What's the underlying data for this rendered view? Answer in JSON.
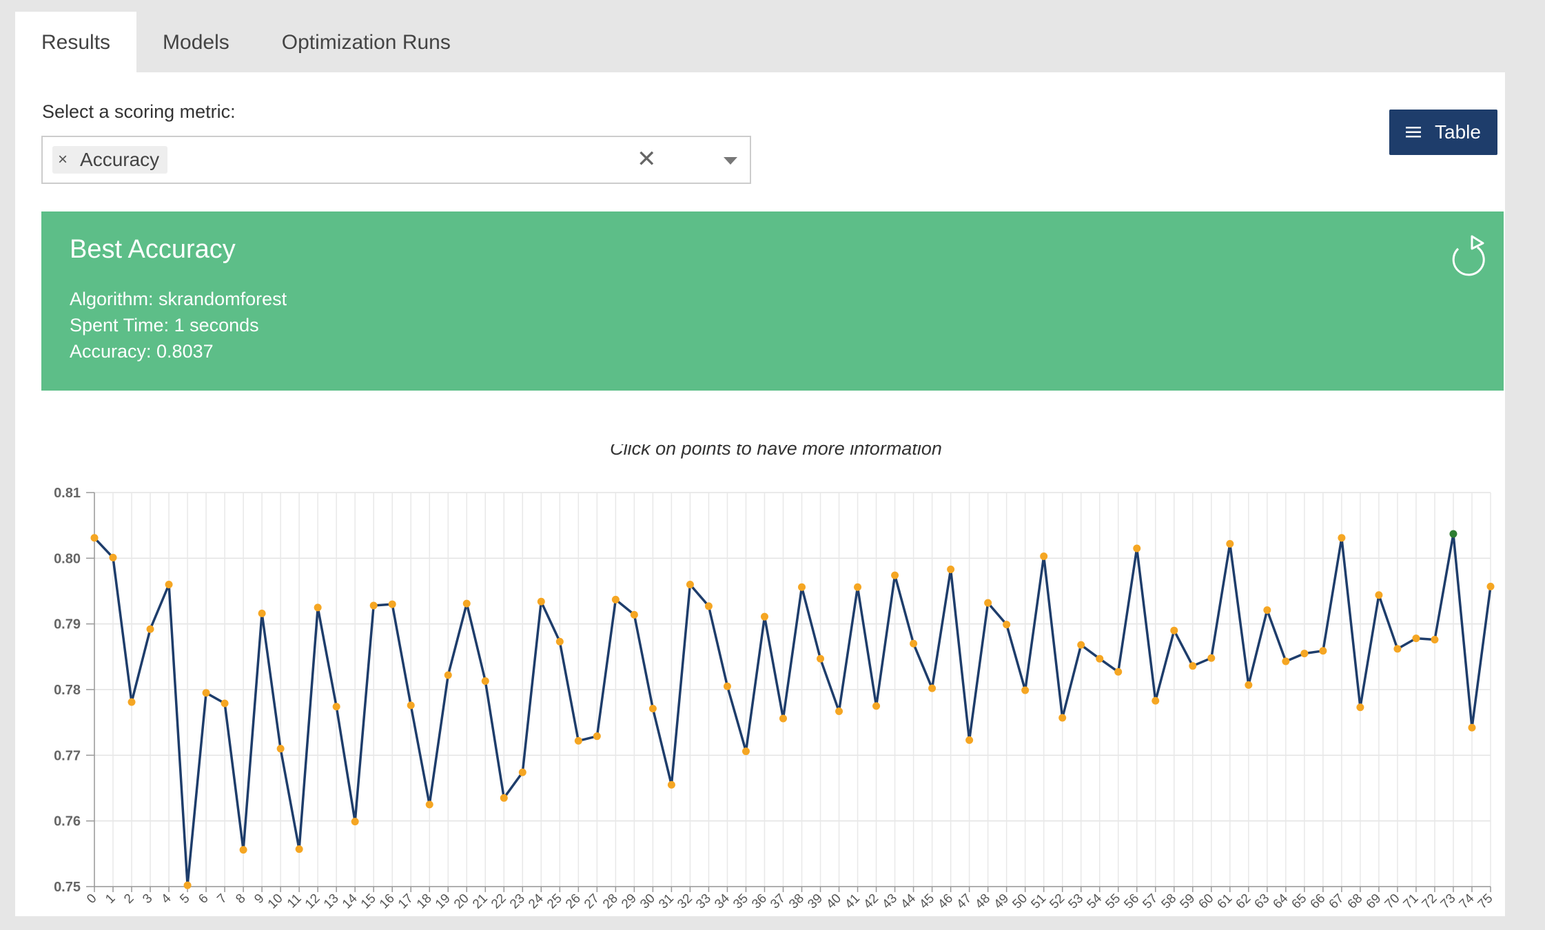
{
  "tabs": [
    "Results",
    "Models",
    "Optimization Runs"
  ],
  "metric": {
    "label": "Select a scoring metric:",
    "selected": "Accuracy",
    "chip_remove": "×",
    "clear": "✕"
  },
  "table_button": {
    "icon": "list-icon",
    "label": "Table"
  },
  "best": {
    "title": "Best Accuracy",
    "algorithm": "Algorithm: skrandomforest",
    "spent_time": "Spent Time: 1 seconds",
    "accuracy": "Accuracy: 0.8037",
    "refresh_icon": "refresh-icon",
    "bg_color": "#5dbe88"
  },
  "chart_data": {
    "type": "line",
    "caption": "Click on points to have more information",
    "ylim": [
      0.75,
      0.81
    ],
    "yticks": [
      "0.75",
      "0.76",
      "0.77",
      "0.78",
      "0.79",
      "0.80",
      "0.81"
    ],
    "x": [
      "0",
      "1",
      "2",
      "3",
      "4",
      "5",
      "6",
      "7",
      "8",
      "9",
      "10",
      "11",
      "12",
      "13",
      "14",
      "15",
      "16",
      "17",
      "18",
      "19",
      "20",
      "21",
      "22",
      "23",
      "24",
      "25",
      "26",
      "27",
      "28",
      "29",
      "30",
      "31",
      "32",
      "33",
      "34",
      "35",
      "36",
      "37",
      "38",
      "39",
      "40",
      "41",
      "42",
      "43",
      "44",
      "45",
      "46",
      "47",
      "48",
      "49",
      "50",
      "51",
      "52",
      "53",
      "54",
      "55",
      "56",
      "57",
      "58",
      "59",
      "60",
      "61",
      "62",
      "63",
      "64",
      "65",
      "66",
      "67",
      "68",
      "69",
      "70",
      "71",
      "72",
      "73",
      "74",
      "75"
    ],
    "series": [
      {
        "name": "accuracy",
        "color": "#1e3d6b",
        "point_color": "#f5a623",
        "best_point_color": "#2e7d32",
        "best_index": 73,
        "values": [
          0.8031,
          0.8001,
          0.7781,
          0.7892,
          0.796,
          0.7502,
          0.7795,
          0.7779,
          0.7556,
          0.7916,
          0.771,
          0.7557,
          0.7925,
          0.7774,
          0.7599,
          0.7928,
          0.793,
          0.7776,
          0.7625,
          0.7822,
          0.7931,
          0.7813,
          0.7635,
          0.7674,
          0.7934,
          0.7873,
          0.7722,
          0.7729,
          0.7937,
          0.7914,
          0.7771,
          0.7655,
          0.796,
          0.7927,
          0.7805,
          0.7706,
          0.7911,
          0.7756,
          0.7956,
          0.7847,
          0.7767,
          0.7956,
          0.7775,
          0.7974,
          0.787,
          0.7802,
          0.7983,
          0.7723,
          0.7932,
          0.7899,
          0.7799,
          0.8003,
          0.7757,
          0.7868,
          0.7847,
          0.7827,
          0.8015,
          0.7783,
          0.789,
          0.7836,
          0.7848,
          0.8022,
          0.7807,
          0.7921,
          0.7843,
          0.7855,
          0.7859,
          0.8031,
          0.7773,
          0.7944,
          0.7862,
          0.7878,
          0.7876,
          0.8037,
          0.7742,
          0.7957
        ]
      }
    ]
  }
}
